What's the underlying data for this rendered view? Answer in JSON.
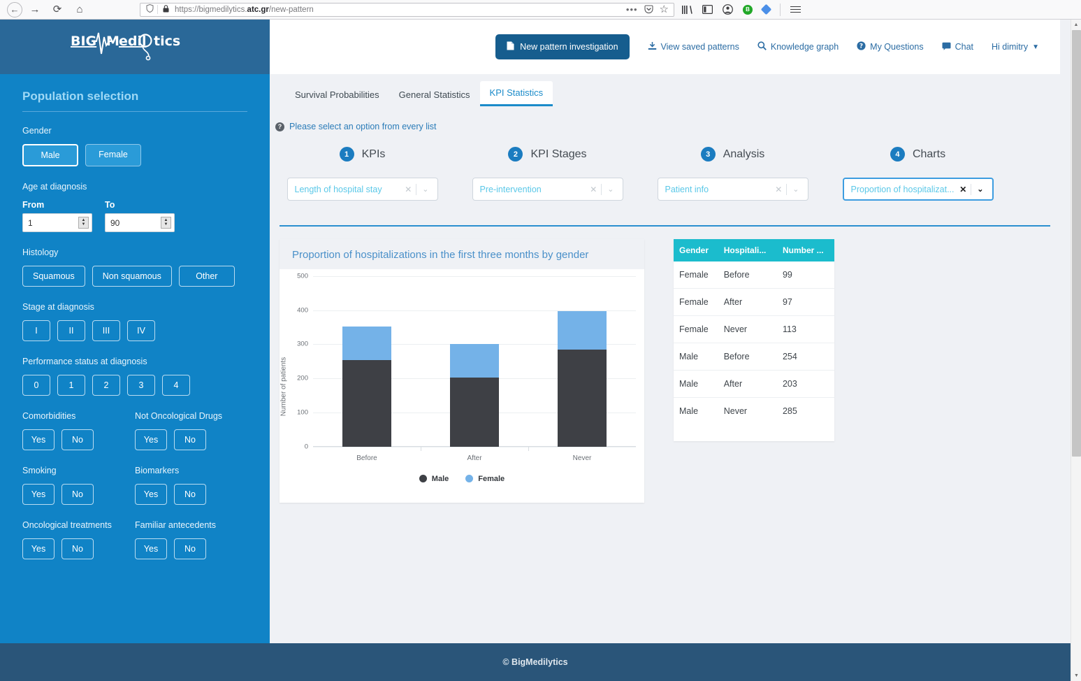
{
  "browser": {
    "back_icon": "←",
    "forward_icon": "→",
    "reload_icon": "⟳",
    "home_icon": "⌂",
    "shield_icon": "shield",
    "lock_icon": "🔒",
    "url_prefix": "https://bigmedilytics.",
    "url_bold": "atc.gr",
    "url_suffix": "/new-pattern",
    "more_icon": "•••",
    "pocket_icon": "pocket",
    "star_icon": "☆",
    "library_icon": "library",
    "sidebar_icon": "sidebar",
    "account_icon": "account",
    "badge_label": "B",
    "menu_icon": "menu"
  },
  "sidebar": {
    "logo": {
      "part1": "BIG",
      "part2": "edil",
      "part3": "tics",
      "letter_m": "M"
    },
    "title": "Population selection",
    "groups": [
      {
        "label": "Gender",
        "buttons": [
          {
            "label": "Male",
            "selected": true
          },
          {
            "label": "Female",
            "selected": false
          }
        ]
      }
    ],
    "age": {
      "label": "Age at diagnosis",
      "from_caption": "From",
      "to_caption": "To",
      "from_value": "1",
      "to_value": "90"
    },
    "histology": {
      "label": "Histology",
      "buttons": [
        "Squamous",
        "Non squamous",
        "Other"
      ]
    },
    "stage": {
      "label": "Stage at diagnosis",
      "buttons": [
        "I",
        "II",
        "III",
        "IV"
      ]
    },
    "performance": {
      "label": "Performance status at diagnosis",
      "buttons": [
        "0",
        "1",
        "2",
        "3",
        "4"
      ]
    },
    "yesno": {
      "yes": "Yes",
      "no": "No"
    },
    "pairs": [
      {
        "left": "Comorbidities",
        "right": "Not Oncological Drugs"
      },
      {
        "left": "Smoking",
        "right": "Biomarkers"
      },
      {
        "left": "Oncological treatments",
        "right": "Familiar antecedents"
      }
    ]
  },
  "topnav": {
    "new_pattern": "New pattern investigation",
    "view_saved": "View saved patterns",
    "knowledge_graph": "Knowledge graph",
    "my_questions": "My Questions",
    "chat": "Chat",
    "user": "Hi dimitry"
  },
  "tabs": [
    {
      "label": "Survival Probabilities",
      "active": false
    },
    {
      "label": "General Statistics",
      "active": false
    },
    {
      "label": "KPI Statistics",
      "active": true
    }
  ],
  "hint": "Please select an option from every list",
  "steps": [
    {
      "num": "1",
      "title": "KPIs",
      "value": "Length of hospital stay",
      "focused": false
    },
    {
      "num": "2",
      "title": "KPI Stages",
      "value": "Pre-intervention",
      "focused": false
    },
    {
      "num": "3",
      "title": "Analysis",
      "value": "Patient info",
      "focused": false
    },
    {
      "num": "4",
      "title": "Charts",
      "value": "Proportion of hospitalizat...",
      "focused": true
    }
  ],
  "chart_data": {
    "type": "bar",
    "stacked": true,
    "title": "Proportion of hospitalizations in the first three months by gender",
    "xlabel": "",
    "ylabel": "Number of patients",
    "categories": [
      "Before",
      "After",
      "Never"
    ],
    "series": [
      {
        "name": "Male",
        "color": "#3e4045",
        "values": [
          254,
          203,
          285
        ]
      },
      {
        "name": "Female",
        "color": "#74b2e8",
        "values": [
          99,
          97,
          113
        ]
      }
    ],
    "ylim": [
      0,
      500
    ],
    "yticks": [
      0,
      100,
      200,
      300,
      400,
      500
    ],
    "grid": true,
    "legend_position": "bottom"
  },
  "table": {
    "columns": [
      "Gender",
      "Hospitali...",
      "Number ..."
    ],
    "rows": [
      [
        "Female",
        "Before",
        "99"
      ],
      [
        "Female",
        "After",
        "97"
      ],
      [
        "Female",
        "Never",
        "113"
      ],
      [
        "Male",
        "Before",
        "254"
      ],
      [
        "Male",
        "After",
        "203"
      ],
      [
        "Male",
        "Never",
        "285"
      ]
    ]
  },
  "footer": "© BigMedilytics"
}
